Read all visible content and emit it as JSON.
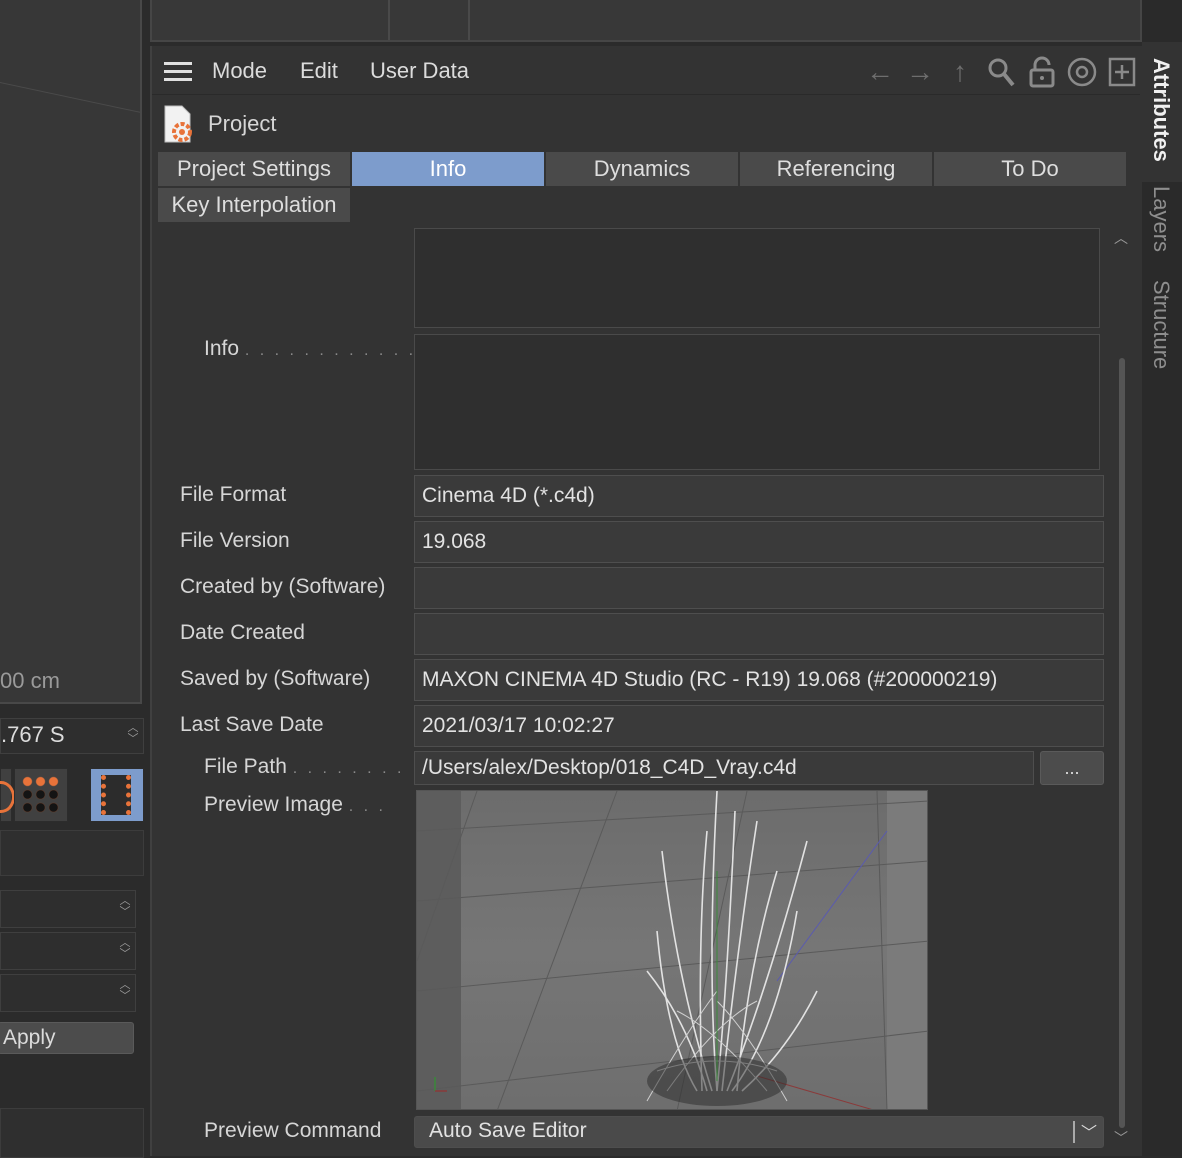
{
  "left_panel": {
    "viewport_value": "00 cm",
    "time_value": ".767 S",
    "apply_label": "Apply"
  },
  "menubar": {
    "items": [
      "Mode",
      "Edit",
      "User Data"
    ]
  },
  "object": {
    "title": "Project"
  },
  "tabs": [
    {
      "label": "Project Settings",
      "active": false
    },
    {
      "label": "Info",
      "active": true
    },
    {
      "label": "Dynamics",
      "active": false
    },
    {
      "label": "Referencing",
      "active": false
    },
    {
      "label": "To Do",
      "active": false
    },
    {
      "label": "Key Interpolation",
      "active": false
    }
  ],
  "fields": {
    "info_label": "Info",
    "file_format_label": "File Format",
    "file_format_value": "Cinema 4D (*.c4d)",
    "file_version_label": "File Version",
    "file_version_value": "19.068",
    "created_by_label": "Created by (Software)",
    "created_by_value": "",
    "date_created_label": "Date Created",
    "date_created_value": "",
    "saved_by_label": "Saved by (Software)",
    "saved_by_value": "MAXON CINEMA 4D Studio (RC - R19) 19.068 (#200000219)",
    "last_save_label": "Last Save Date",
    "last_save_value": "2021/03/17 10:02:27",
    "file_path_label": "File Path",
    "file_path_value": "/Users/alex/Desktop/018_C4D_Vray.c4d",
    "browse_label": "...",
    "preview_image_label": "Preview Image",
    "preview_command_label": "Preview Command",
    "preview_command_value": "Auto Save Editor"
  },
  "side_tabs": [
    "Attributes",
    "Layers",
    "Structure"
  ],
  "colors": {
    "accent": "#7d9ccc",
    "panel": "#333333",
    "icon_orange": "#e8733a"
  }
}
